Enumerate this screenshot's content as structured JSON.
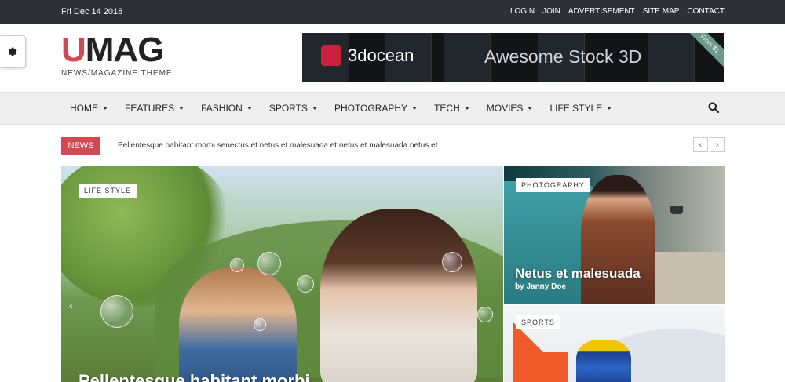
{
  "topbar": {
    "date": "Fri Dec 14 2018",
    "links": [
      "LOGIN",
      "JOIN",
      "ADVERTISEMENT",
      "SITE MAP",
      "CONTACT"
    ]
  },
  "logo": {
    "first_letter": "U",
    "rest": "MAG",
    "tagline": "NEWS/MAGAZINE THEME"
  },
  "banner": {
    "brand": "3docean",
    "slogan": "Awesome Stock 3D",
    "ribbon": "From $1"
  },
  "nav": {
    "items": [
      "HOME",
      "FEATURES",
      "FASHION",
      "SPORTS",
      "PHOTOGRAPHY",
      "TECH",
      "MOVIES",
      "LIFE STYLE"
    ]
  },
  "ticker": {
    "label": "NEWS",
    "text": "Pellentesque habitant morbi senectus et netus et malesuada et netus et malesuada netus et",
    "prev": "‹",
    "next": "›"
  },
  "hero": {
    "category": "LIFE STYLE",
    "headline": "Pellentesque habitant morbi",
    "prev": "‹"
  },
  "card1": {
    "category": "PHOTOGRAPHY",
    "title": "Netus et malesuada",
    "byline": "by Janny Doe",
    "next": "›"
  },
  "card2": {
    "category": "SPORTS"
  },
  "colors": {
    "accent": "#d14a53",
    "topbar": "#2d3035",
    "navbar": "#efefef"
  }
}
